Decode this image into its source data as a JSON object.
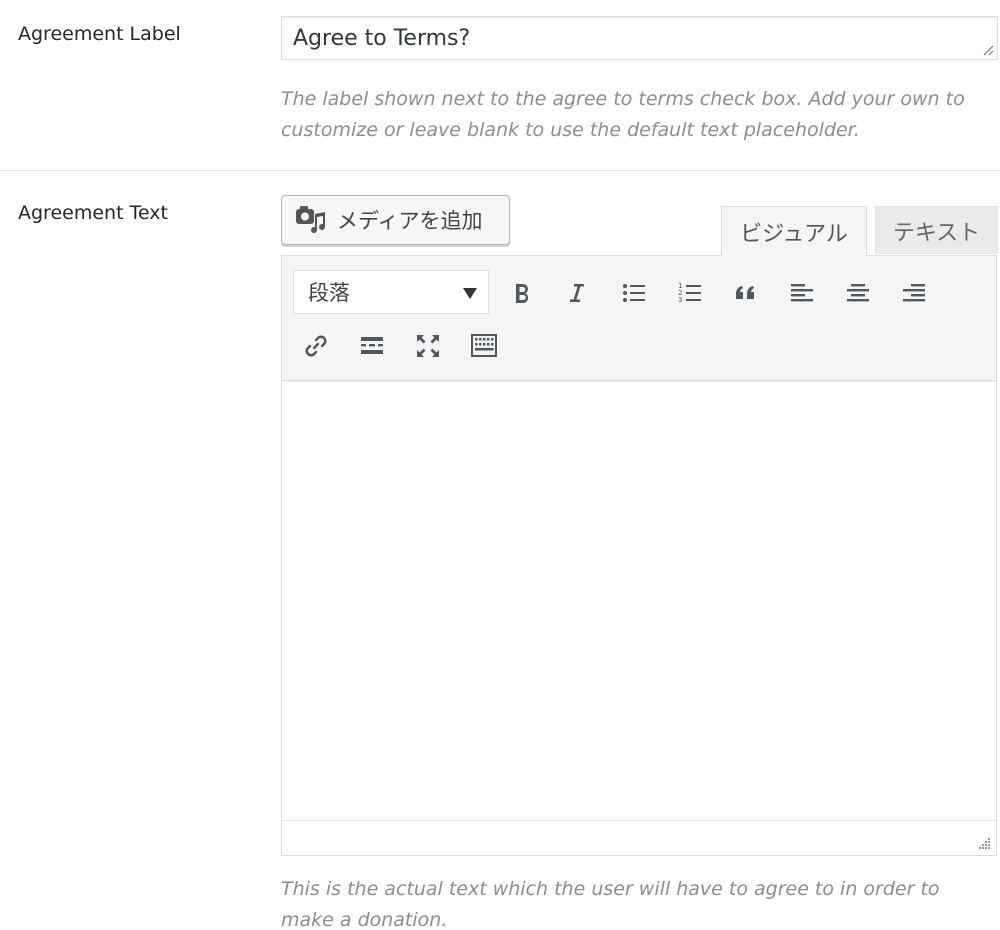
{
  "agreement_label": {
    "row_label": "Agreement Label",
    "value": "Agree to Terms?",
    "description": "The label shown next to the agree to terms check box. Add your own to customize or leave blank to use the default text placeholder."
  },
  "agreement_text": {
    "row_label": "Agreement Text",
    "add_media_label": "メディアを追加",
    "tabs": [
      {
        "label": "ビジュアル",
        "active": true
      },
      {
        "label": "テキスト",
        "active": false
      }
    ],
    "format_select": "段落",
    "toolbar_icons": [
      "bold-icon",
      "italic-icon",
      "bullet-list-icon",
      "numbered-list-icon",
      "blockquote-icon",
      "align-left-icon",
      "align-center-icon",
      "align-right-icon",
      "link-icon",
      "read-more-icon",
      "fullscreen-icon",
      "toolbar-toggle-icon"
    ],
    "description": "This is the actual text which the user will have to agree to in order to make a donation."
  },
  "colors": {
    "text": "#23282d",
    "description": "#8d8d8d",
    "toolbar_bg": "#f5f5f5",
    "border": "#dcdcdc",
    "icon": "#50575e"
  }
}
